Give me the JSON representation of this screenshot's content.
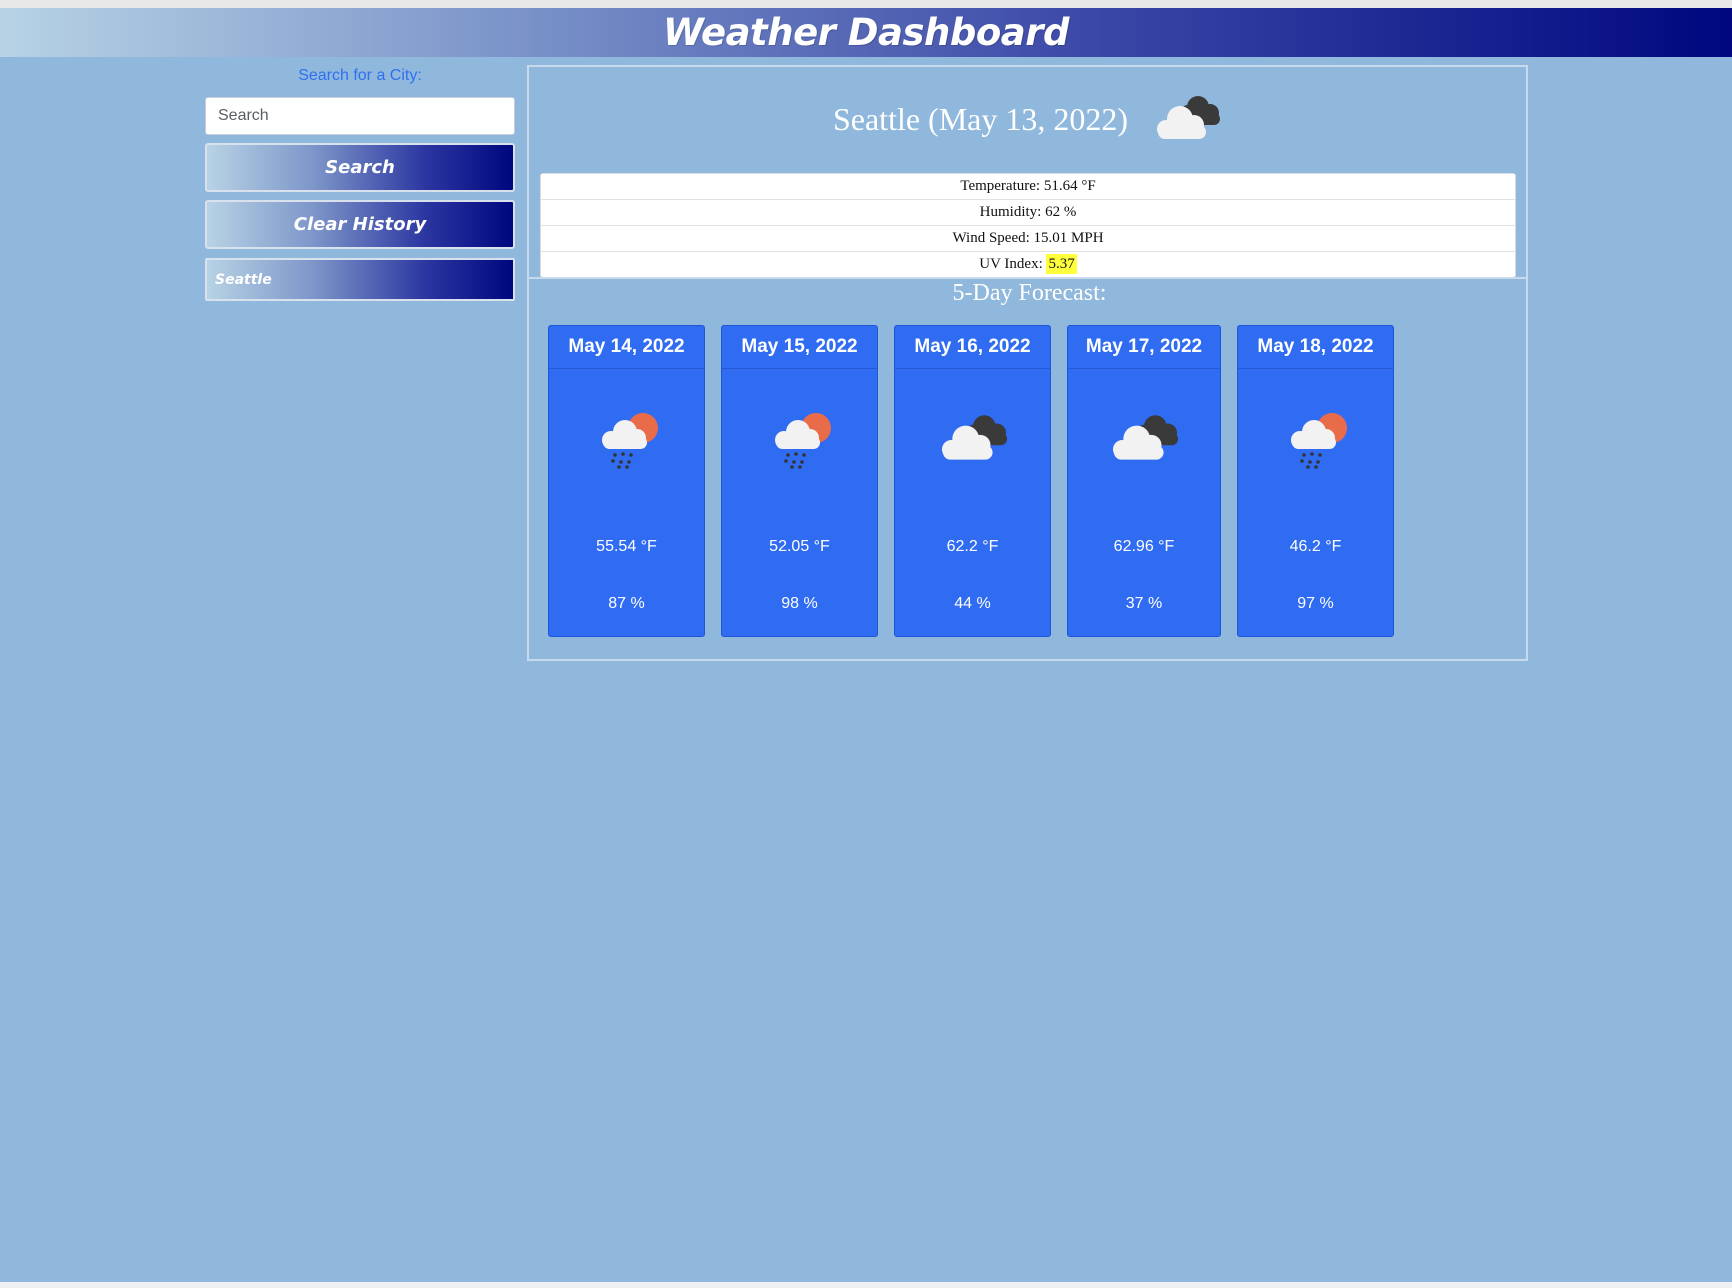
{
  "header": {
    "title": "Weather Dashboard"
  },
  "sidebar": {
    "search_label": "Search for a City:",
    "search_placeholder": "Search",
    "search_value": "",
    "search_button": "Search",
    "clear_button": "Clear History",
    "history": [
      "Seattle"
    ]
  },
  "current": {
    "title": "Seattle (May 13, 2022)",
    "icon": "dark-cloud-icon",
    "temperature_label": "Temperature: 51.64 °F",
    "humidity_label": "Humidity: 62 %",
    "wind_label": "Wind Speed: 15.01 MPH",
    "uv_label": "UV Index: ",
    "uv_value": "5.37"
  },
  "forecast": {
    "title": "5-Day Forecast:",
    "days": [
      {
        "date": "May 14, 2022",
        "icon": "rain-sun-cloud-icon",
        "temp": "55.54 °F",
        "humidity": "87 %"
      },
      {
        "date": "May 15, 2022",
        "icon": "rain-sun-cloud-icon",
        "temp": "52.05 °F",
        "humidity": "98 %"
      },
      {
        "date": "May 16, 2022",
        "icon": "dark-cloud-icon",
        "temp": "62.2 °F",
        "humidity": "44 %"
      },
      {
        "date": "May 17, 2022",
        "icon": "dark-cloud-icon",
        "temp": "62.96 °F",
        "humidity": "37 %"
      },
      {
        "date": "May 18, 2022",
        "icon": "rain-sun-cloud-icon",
        "temp": "46.2 °F",
        "humidity": "97 %"
      }
    ]
  },
  "colors": {
    "page_bg": "#90b8dc",
    "card_bg": "#2f6cf2",
    "accent_text": "#2f6ff0",
    "uv_highlight": "#ffff3b"
  }
}
